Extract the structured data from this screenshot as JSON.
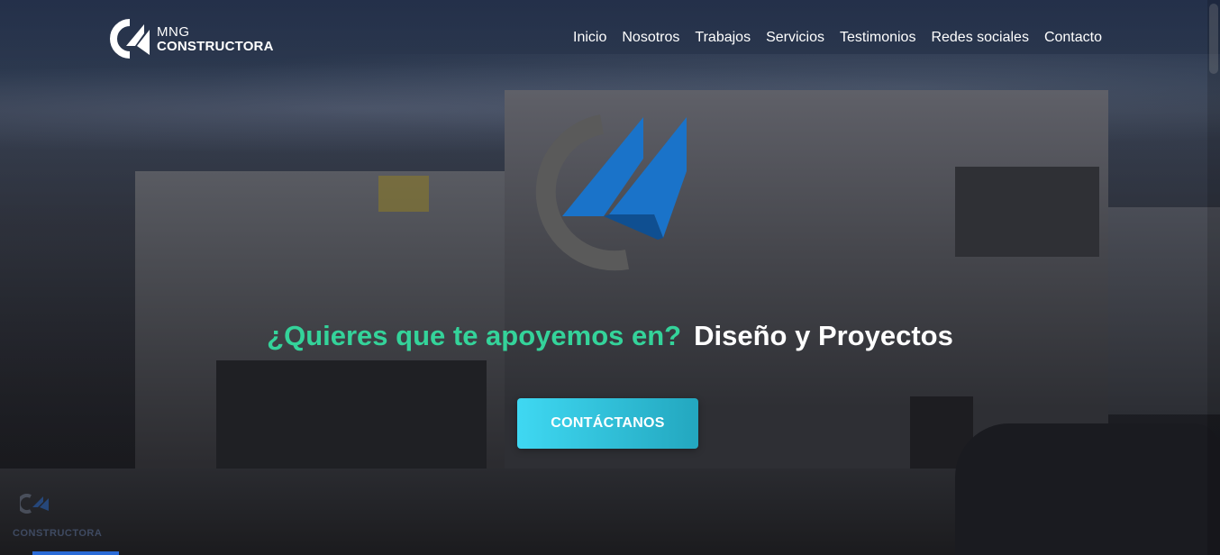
{
  "brand": {
    "line1": "MNG",
    "line2": "CONSTRUCTORA",
    "icon": "mng-logo-icon"
  },
  "nav": {
    "items": [
      {
        "label": "Inicio"
      },
      {
        "label": "Nosotros"
      },
      {
        "label": "Trabajos"
      },
      {
        "label": "Servicios"
      },
      {
        "label": "Testimonios"
      },
      {
        "label": "Redes sociales"
      },
      {
        "label": "Contacto"
      }
    ]
  },
  "hero": {
    "logo_icon": "mng-hero-logo-icon",
    "headline_lead": "¿Quieres que te apoyemos en?",
    "headline_rotator": "Diseño y Proyectos",
    "cta_label": "CONTÁCTANOS",
    "watermark": "CONSTRUCTORA"
  },
  "colors": {
    "accent_green": "#34d39a",
    "cta_start": "#3fd8f2",
    "cta_end": "#23a7bf",
    "logo_blue": "#1a73c9",
    "logo_gray": "#5a5a5a"
  }
}
